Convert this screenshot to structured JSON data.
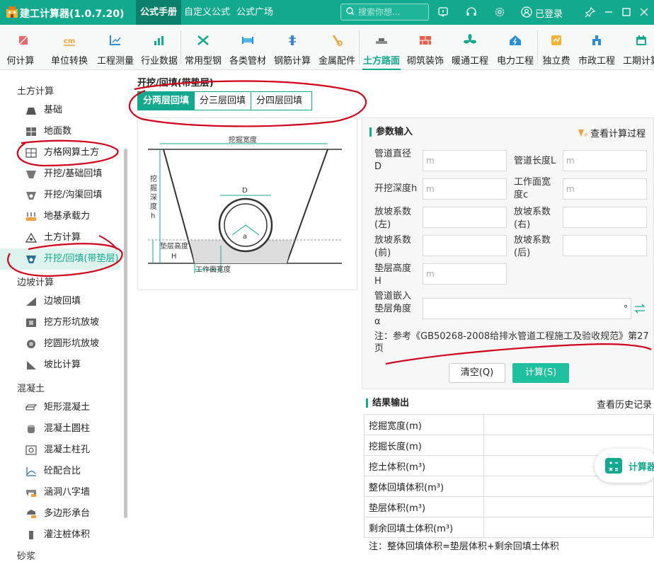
{
  "app": {
    "title": "建工计算器(1.0.7.20)",
    "tabs": [
      "公式手册",
      "自定义公式",
      "公式广场"
    ],
    "search_placeholder": "搜索你想...",
    "login": "已登录"
  },
  "toolbar": {
    "items": [
      "何计算",
      "单位转换",
      "工程测量",
      "行业数据",
      "常用型钢",
      "各类管材",
      "钢筋计算",
      "金属配件",
      "土方路面",
      "砌筑装饰",
      "暖通工程",
      "电力工程",
      "独立费",
      "市政工程",
      "工期计算"
    ],
    "active": "土方路面"
  },
  "sidebar": {
    "categories": [
      "土方计算",
      "边坡计算",
      "混凝土",
      "砂浆"
    ],
    "items": [
      "基础",
      "地面数",
      "方格网算土方",
      "开挖/基础回填",
      "开挖/沟渠回填",
      "地基承载力",
      "土方计算",
      "开挖/回填(带垫层)",
      "边坡回填",
      "挖方形坑放坡",
      "挖圆形坑放坡",
      "坡比计算",
      "矩形混凝土",
      "混凝土圆柱",
      "混凝土柱孔",
      "砼配合比",
      "涵洞八字墙",
      "多边形承台",
      "灌注桩体积"
    ],
    "active": "开挖/回填(带垫层)"
  },
  "main": {
    "title": "开挖/回填(带垫层)",
    "subtabs": [
      "分两层回填",
      "分三层回填",
      "分四层回填"
    ],
    "diagram": {
      "top_label": "挖掘宽度",
      "depth_label": [
        "挖",
        "掘",
        "深",
        "度",
        "h"
      ],
      "d_label": "D",
      "a_label": "a",
      "cushion_label": "垫层高度",
      "h_label": "H",
      "bottom_label": "工作面宽度"
    }
  },
  "params": {
    "title": "参数输入",
    "view_process": "查看计算过程",
    "fields": [
      {
        "label": "管道直径D",
        "unit": "m"
      },
      {
        "label": "管道长度L",
        "unit": "m"
      },
      {
        "label": "开挖深度h",
        "unit": "m"
      },
      {
        "label": "工作面宽度c",
        "unit": "m"
      },
      {
        "label": "放坡系数(左)",
        "unit": ""
      },
      {
        "label": "放坡系数(右)",
        "unit": ""
      },
      {
        "label": "放坡系数(前)",
        "unit": ""
      },
      {
        "label": "放坡系数(后)",
        "unit": ""
      },
      {
        "label": "垫层高度H",
        "unit": "m"
      },
      {
        "label": "管道嵌入垫层角度α",
        "unit": "°"
      }
    ],
    "note": "注：参考《GB50268-2008给排水管道工程施工及验收规范》第27页",
    "clear_label": "清空(Q)",
    "calc_label": "计算(S)"
  },
  "results": {
    "title": "结果输出",
    "history": "查看历史记录",
    "rows": [
      "挖掘宽度(m)",
      "挖掘长度(m)",
      "挖土体积(m³)",
      "整体回填体积(m³)",
      "垫层体积(m³)",
      "剩余回填土体积(m³)"
    ],
    "note": "注：整体回填体积=垫层体积+剩余回填土体积"
  },
  "float_button": {
    "label": "计算器"
  },
  "colors": {
    "brand": "#12a98e",
    "brand_dark": "#0b7f6a",
    "annotation": "#d0021b"
  }
}
